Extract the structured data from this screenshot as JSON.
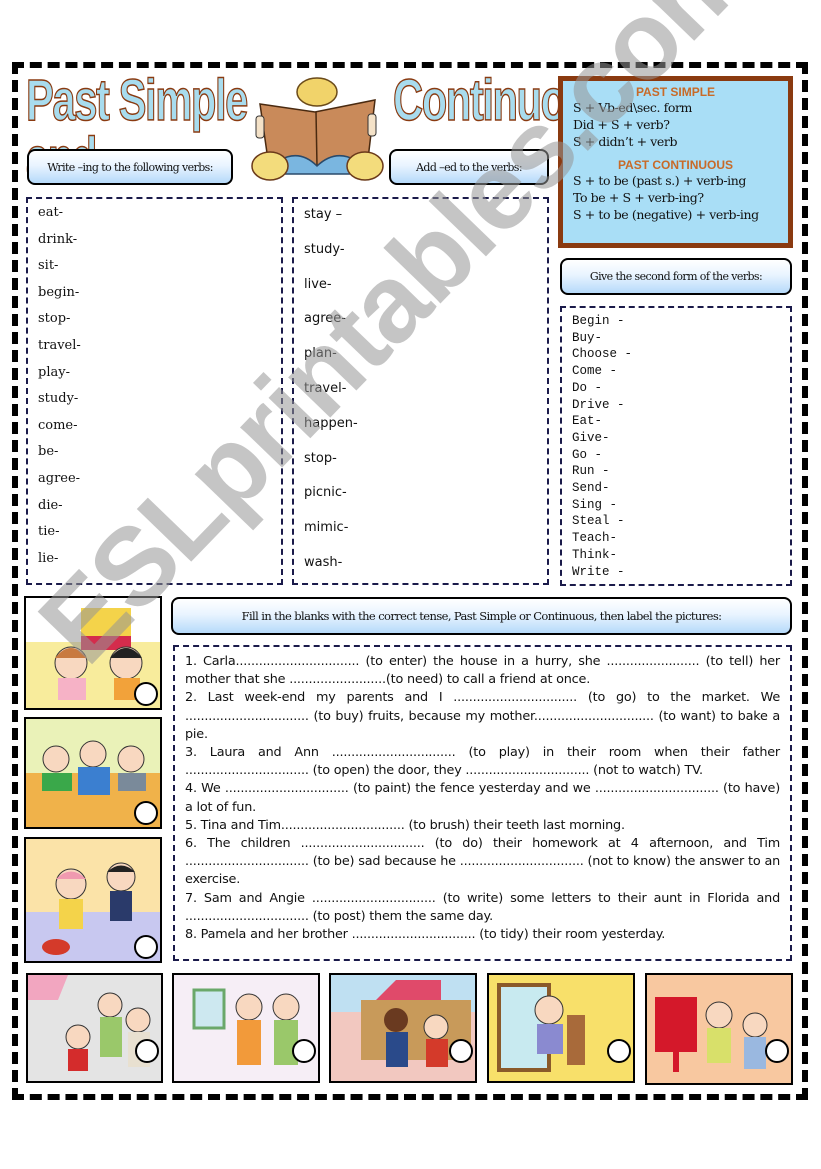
{
  "title": {
    "left": "Past Simple and",
    "right": "Continuous"
  },
  "headings": {
    "ing": "Write –ing to the following verbs:",
    "ed": "Add –ed to the verbs:",
    "second_form": "Give the second form of the verbs:",
    "fill_in": "Fill in the blanks with the correct tense, Past Simple or Continuous, then label the pictures:"
  },
  "formula_box": {
    "past_simple_title": "PAST SIMPLE",
    "past_simple_lines": [
      "S + Vb-ed\\sec. form",
      "Did + S +  verb?",
      "S + didn’t + verb"
    ],
    "past_continuous_title": "PAST CONTINUOUS",
    "past_continuous_lines": [
      "S + to be (past s.) + verb-ing",
      "To be + S + verb-ing?",
      "S + to be (negative) + verb-ing"
    ]
  },
  "ing_verbs": [
    "eat-",
    "drink-",
    "sit-",
    "begin-",
    "stop-",
    "travel-",
    "play-",
    "study-",
    "come-",
    "be-",
    "agree-",
    "die-",
    "tie-",
    "lie-"
  ],
  "ed_verbs": [
    "stay –",
    "study-",
    "live-",
    "agree-",
    "plan-",
    "travel-",
    "happen-",
    "stop-",
    "picnic-",
    "mimic-",
    "wash-"
  ],
  "second_form_verbs": [
    "Begin -",
    "Buy-",
    "Choose -",
    "Come -",
    "Do -",
    "Drive -",
    "Eat-",
    "Give-",
    "Go -",
    "Run -",
    "Send-",
    "Sing -",
    "Steal -",
    "Teach-",
    "Think-",
    "Write -"
  ],
  "exercise": [
    "1. Carla................................ (to enter) the house in a hurry, she ........................ (to tell) her mother that she .........................(to need) to call a friend at once.",
    "2. Last week-end my parents and I ................................ (to go) to the market. We ................................ (to buy) fruits, because my mother............................... (to want) to bake a pie.",
    "3. Laura and Ann ................................ (to play) in their room when their father ................................ (to open) the door, they ................................ (not to watch) TV.",
    "4. We ................................ (to paint) the fence yesterday and we ................................ (to have) a lot of fun.",
    "5. Tina and Tim................................ (to brush) their teeth last morning.",
    "6. The children ................................ (to do) their homework at 4 afternoon, and Tim ................................ (to be) sad because he ................................ (not to know) the answer to an exercise.",
    "7. Sam and Angie ................................ (to write) some letters to their aunt in Florida and ................................ (to post) them the same day.",
    "8. Pamela and her brother ................................ (to tidy) their room yesterday."
  ],
  "pictures": [
    {
      "name": "picture-party",
      "scene": "children playing with toys"
    },
    {
      "name": "picture-studying",
      "scene": "children studying at a table"
    },
    {
      "name": "picture-cleaning",
      "scene": "children cleaning the room"
    },
    {
      "name": "picture-market",
      "scene": "family at the market"
    },
    {
      "name": "picture-brushing-teeth",
      "scene": "children brushing teeth"
    },
    {
      "name": "picture-painting-fence",
      "scene": "children painting a fence"
    },
    {
      "name": "picture-entering-house",
      "scene": "girl entering house"
    },
    {
      "name": "picture-posting-letters",
      "scene": "posting letters at a mailbox"
    }
  ],
  "watermark": "ESLprintables.com",
  "colors": {
    "title_fill": "#a8dcee",
    "title_outline": "#8a3a10",
    "formula_bg": "#a9def6",
    "formula_border": "#8a3a10",
    "formula_heading": "#c86a28",
    "dash_color": "#1a1a4a"
  }
}
